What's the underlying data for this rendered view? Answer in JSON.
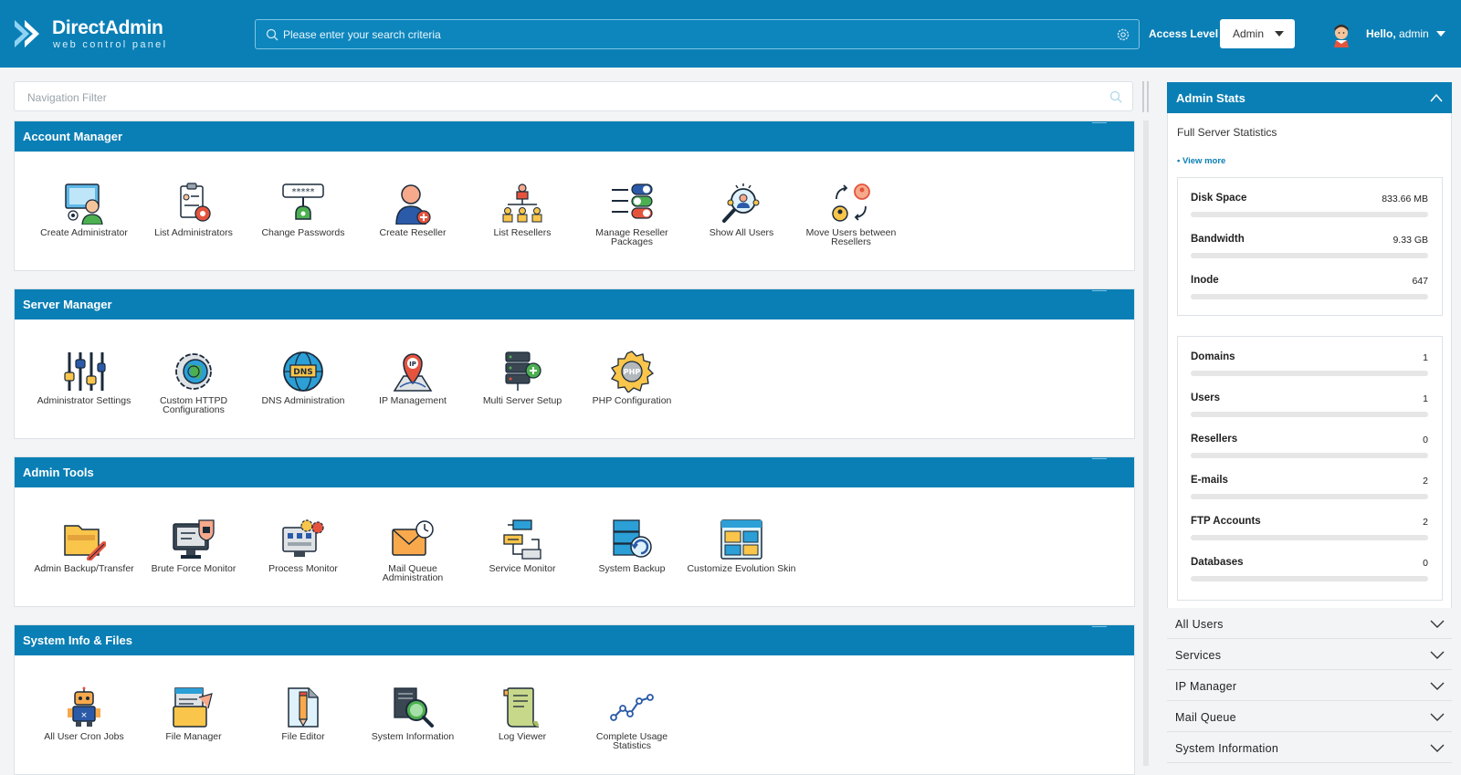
{
  "header": {
    "logo_title": "DirectAdmin",
    "logo_sub": "web control panel",
    "search_placeholder": "Please enter your search criteria",
    "access_label": "Access Level",
    "access_value": "Admin",
    "hello_prefix": "Hello,",
    "hello_user": "admin"
  },
  "nav_filter": {
    "placeholder": "Navigation Filter"
  },
  "sections": [
    {
      "title": "Account Manager",
      "items": [
        {
          "label": "Create Administrator",
          "icon": "create-administrator-icon"
        },
        {
          "label": "List Administrators",
          "icon": "list-administrators-icon"
        },
        {
          "label": "Change Passwords",
          "icon": "change-passwords-icon"
        },
        {
          "label": "Create Reseller",
          "icon": "create-reseller-icon"
        },
        {
          "label": "List Resellers",
          "icon": "list-resellers-icon"
        },
        {
          "label": "Manage Reseller Packages",
          "icon": "manage-reseller-packages-icon"
        },
        {
          "label": "Show All Users",
          "icon": "show-all-users-icon"
        },
        {
          "label": "Move Users between Resellers",
          "icon": "move-users-icon"
        }
      ]
    },
    {
      "title": "Server Manager",
      "items": [
        {
          "label": "Administrator Settings",
          "icon": "administrator-settings-icon"
        },
        {
          "label": "Custom HTTPD Configurations",
          "icon": "custom-httpd-icon"
        },
        {
          "label": "DNS Administration",
          "icon": "dns-administration-icon"
        },
        {
          "label": "IP Management",
          "icon": "ip-management-icon"
        },
        {
          "label": "Multi Server Setup",
          "icon": "multi-server-setup-icon"
        },
        {
          "label": "PHP Configuration",
          "icon": "php-configuration-icon"
        }
      ]
    },
    {
      "title": "Admin Tools",
      "items": [
        {
          "label": "Admin Backup/Transfer",
          "icon": "admin-backup-icon"
        },
        {
          "label": "Brute Force Monitor",
          "icon": "brute-force-monitor-icon"
        },
        {
          "label": "Process Monitor",
          "icon": "process-monitor-icon"
        },
        {
          "label": "Mail Queue Administration",
          "icon": "mail-queue-icon"
        },
        {
          "label": "Service Monitor",
          "icon": "service-monitor-icon"
        },
        {
          "label": "System Backup",
          "icon": "system-backup-icon"
        },
        {
          "label": "Customize Evolution Skin",
          "icon": "customize-skin-icon"
        }
      ]
    },
    {
      "title": "System Info & Files",
      "items": [
        {
          "label": "All User Cron Jobs",
          "icon": "cron-jobs-icon"
        },
        {
          "label": "File Manager",
          "icon": "file-manager-icon"
        },
        {
          "label": "File Editor",
          "icon": "file-editor-icon"
        },
        {
          "label": "System Information",
          "icon": "system-information-icon"
        },
        {
          "label": "Log Viewer",
          "icon": "log-viewer-icon"
        },
        {
          "label": "Complete Usage Statistics",
          "icon": "usage-statistics-icon"
        }
      ]
    }
  ],
  "admin_stats": {
    "title": "Admin Stats",
    "subtitle": "Full Server Statistics",
    "view_more": "• View more",
    "resources": [
      {
        "label": "Disk Space",
        "value": "833.66 MB"
      },
      {
        "label": "Bandwidth",
        "value": "9.33 GB"
      },
      {
        "label": "Inode",
        "value": "647"
      }
    ],
    "counts": [
      {
        "label": "Domains",
        "value": "1"
      },
      {
        "label": "Users",
        "value": "1"
      },
      {
        "label": "Resellers",
        "value": "0"
      },
      {
        "label": "E-mails",
        "value": "2"
      },
      {
        "label": "FTP Accounts",
        "value": "2"
      },
      {
        "label": "Databases",
        "value": "0"
      }
    ]
  },
  "accordions": [
    "All Users",
    "Services",
    "IP Manager",
    "Mail Queue",
    "System Information"
  ],
  "colors": {
    "brand": "#0a7fb5",
    "background": "#f3f4f6"
  }
}
